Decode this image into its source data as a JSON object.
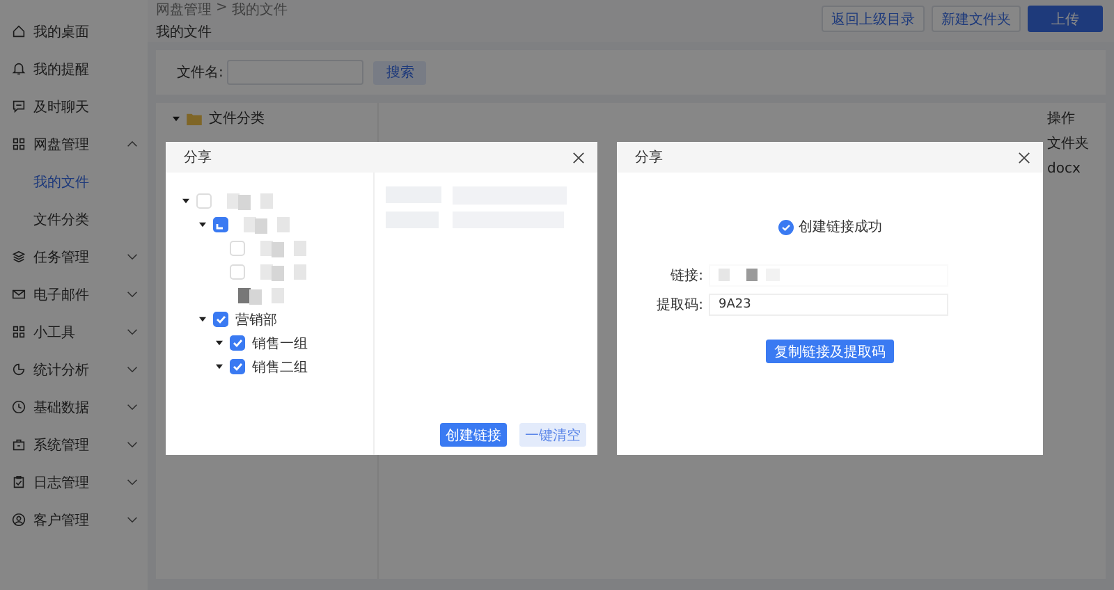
{
  "sidebar": {
    "items": [
      {
        "label": "我的桌面"
      },
      {
        "label": "我的提醒"
      },
      {
        "label": "及时聊天"
      },
      {
        "label": "网盘管理",
        "expanded": true,
        "children": [
          {
            "label": "我的文件",
            "selected": true
          },
          {
            "label": "文件分类",
            "selected": false
          }
        ]
      },
      {
        "label": "任务管理",
        "expanded": false
      },
      {
        "label": "电子邮件",
        "expanded": false
      },
      {
        "label": "小工具",
        "expanded": false
      },
      {
        "label": "统计分析",
        "expanded": false
      },
      {
        "label": "基础数据",
        "expanded": false
      },
      {
        "label": "系统管理",
        "expanded": false
      },
      {
        "label": "日志管理",
        "expanded": false
      },
      {
        "label": "客户管理",
        "expanded": false
      }
    ]
  },
  "header": {
    "breadcrumb": [
      "网盘管理",
      "我的文件"
    ],
    "separator": ">",
    "title": "我的文件",
    "buttons": [
      {
        "label": "返回上级目录",
        "kind": "outline"
      },
      {
        "label": "新建文件夹",
        "kind": "outline"
      },
      {
        "label": "上传",
        "kind": "primary"
      }
    ]
  },
  "search": {
    "label": "文件名:",
    "button": "搜索"
  },
  "file_tree": {
    "root": "文件分类",
    "expanded": true
  },
  "table": {
    "columns": [
      "操作"
    ],
    "rows": [
      [
        "文件夹"
      ],
      [
        "docx"
      ]
    ]
  },
  "dialogs": [
    {
      "kind": "tree",
      "title": "分享",
      "tree": [
        {
          "checked": false,
          "expanded": true,
          "blurred": true,
          "children": [
            {
              "checked": false,
              "indeterminate": true,
              "expanded": true,
              "blurred": true,
              "children": [
                {
                  "checked": false,
                  "blurred": true
                },
                {
                  "checked": false,
                  "blurred": true
                },
                {
                  "kind": "plain",
                  "blurred": true
                }
              ]
            },
            {
              "checked": true,
              "expanded": true,
              "label": "营销部",
              "children": [
                {
                  "checked": true,
                  "expanded": true,
                  "label": "销售一组"
                },
                {
                  "checked": true,
                  "expanded": true,
                  "label": "销售二组"
                }
              ]
            }
          ]
        }
      ],
      "preview": {
        "blurred": true
      },
      "buttons": [
        {
          "label": "创建链接",
          "kind": "primary"
        },
        {
          "label": "一键清空",
          "kind": "light"
        }
      ]
    },
    {
      "kind": "result",
      "title": "分享",
      "message": "创建链接成功",
      "fields": [
        {
          "label": "链接:",
          "blurred": true
        },
        {
          "label": "提取码:",
          "value": "9A23"
        }
      ],
      "button": "复制链接及提取码"
    }
  ]
}
